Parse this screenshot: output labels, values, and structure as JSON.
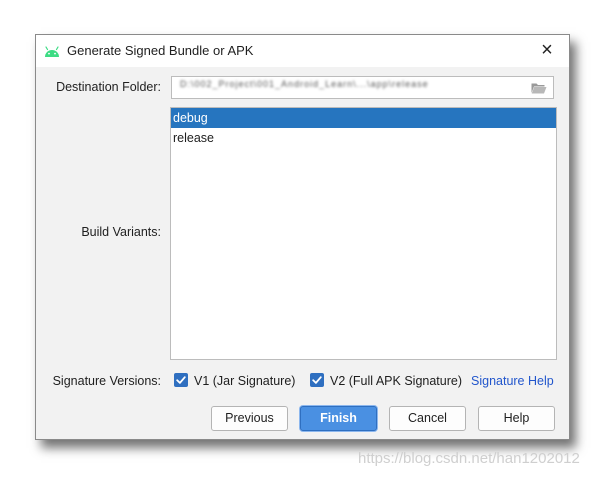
{
  "window": {
    "title": "Generate Signed Bundle or APK",
    "close_glyph": "×",
    "icon": "android-icon"
  },
  "destination": {
    "label": "Destination Folder:",
    "value": "D:\\002_Project\\001_Android_Learn\\...\\app\\release",
    "icon": "folder-icon"
  },
  "build_variants": {
    "label": "Build Variants:",
    "items": [
      {
        "label": "debug",
        "selected": true
      },
      {
        "label": "release",
        "selected": false
      }
    ]
  },
  "signature": {
    "label": "Signature Versions:",
    "v1": {
      "label": "V1 (Jar Signature)",
      "checked": true
    },
    "v2": {
      "label": "V2 (Full APK Signature)",
      "checked": true
    },
    "help_link": "Signature Help"
  },
  "buttons": {
    "previous": "Previous",
    "finish": "Finish",
    "cancel": "Cancel",
    "help": "Help"
  },
  "watermark": "https://blog.csdn.net/han1202012",
  "colors": {
    "selection": "#2675bf",
    "primary_button": "#4a90e2",
    "checkbox": "#2f6fc0",
    "link": "#2256cc",
    "android_green": "#3ddc84"
  }
}
